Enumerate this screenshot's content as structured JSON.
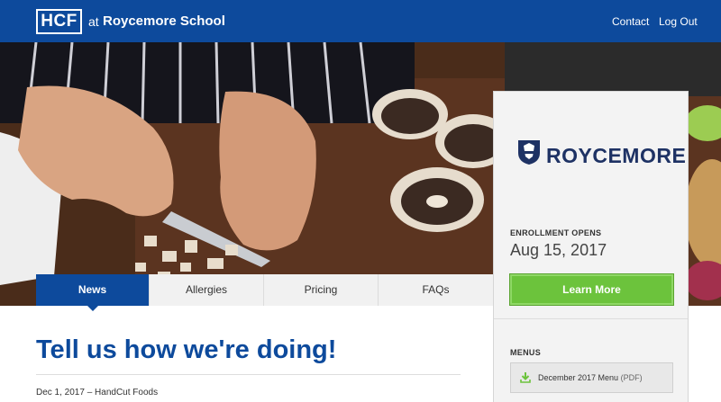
{
  "header": {
    "logo_text": "HCF",
    "at_text": "at",
    "school_name": "Roycemore School",
    "nav": {
      "contact": "Contact",
      "logout": "Log Out"
    }
  },
  "tabs": [
    {
      "label": "News",
      "active": true
    },
    {
      "label": "Allergies",
      "active": false
    },
    {
      "label": "Pricing",
      "active": false
    },
    {
      "label": "FAQs",
      "active": false
    }
  ],
  "article": {
    "headline": "Tell us how we're doing!",
    "byline": "Dec 1, 2017 – HandCut Foods"
  },
  "sidebar": {
    "school_logo_text": "ROYCEMORE",
    "enrollment_label": "ENROLLMENT OPENS",
    "enrollment_date": "Aug 15, 2017",
    "cta_label": "Learn More",
    "menus_label": "MENUS",
    "menu_item_title": "December 2017 Menu",
    "menu_item_format": "(PDF)"
  },
  "colors": {
    "brand_blue": "#0d4a9c",
    "cta_green": "#6cc33c",
    "navy_logo": "#1e3264"
  },
  "icons": [
    "download-icon",
    "crest-icon"
  ]
}
